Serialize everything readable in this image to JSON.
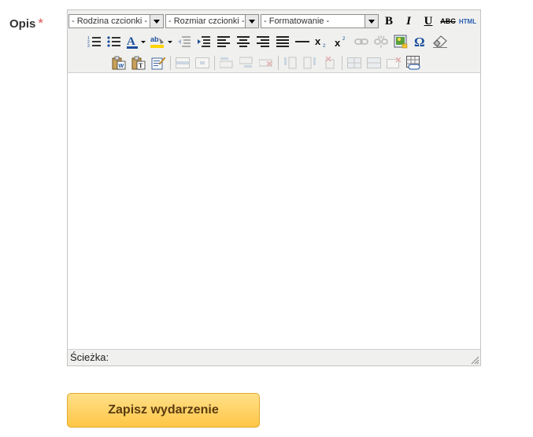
{
  "form": {
    "label": "Opis",
    "required_mark": "*"
  },
  "editor": {
    "selects": {
      "font_family": "- Rodzina czcionki -",
      "font_size": "- Rozmiar czcionki -",
      "format": "- Formatowanie -"
    },
    "buttons": {
      "bold": "B",
      "italic": "I",
      "underline": "U",
      "strike": "ABC",
      "html": "HTML"
    },
    "status": {
      "path_label": "Ścieżka:"
    }
  },
  "submit": {
    "label": "Zapisz wydarzenie"
  }
}
